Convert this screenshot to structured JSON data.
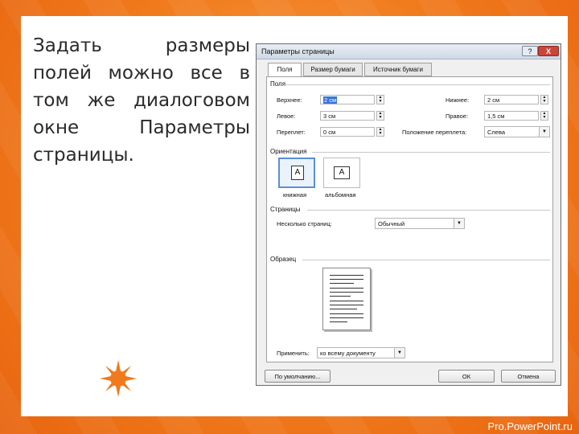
{
  "slide": {
    "text": "Задать размеры полей можно все в том же диалоговом окне Параметры страницы.",
    "watermark": "Pro.PowerPoint.ru"
  },
  "dialog": {
    "title": "Параметры страницы",
    "help": "?",
    "close": "X",
    "tabs": [
      "Поля",
      "Размер бумаги",
      "Источник бумаги"
    ],
    "active_tab": "Поля",
    "margins": {
      "section": "Поля",
      "top_label": "Верхнее:",
      "top_value": "2 см",
      "bottom_label": "Нижнее:",
      "bottom_value": "2 см",
      "left_label": "Левое:",
      "left_value": "3 см",
      "right_label": "Правое:",
      "right_value": "1,5 см",
      "gutter_label": "Переплет:",
      "gutter_value": "0 см",
      "gutter_pos_label": "Положение переплета:",
      "gutter_pos_value": "Слева"
    },
    "orientation": {
      "section": "Ориентация",
      "portrait": "книжная",
      "landscape": "альбомная",
      "selected": "книжная"
    },
    "pages": {
      "section": "Страницы",
      "multiple_label": "Несколько страниц:",
      "multiple_value": "Обычный"
    },
    "preview": {
      "section": "Образец"
    },
    "apply": {
      "label": "Применить:",
      "value": "ко всему документу"
    },
    "buttons": {
      "default": "По умолчанию...",
      "ok": "ОК",
      "cancel": "Отмена"
    }
  },
  "colors": {
    "accent": "#f07a1c",
    "selection": "#3875d7"
  }
}
